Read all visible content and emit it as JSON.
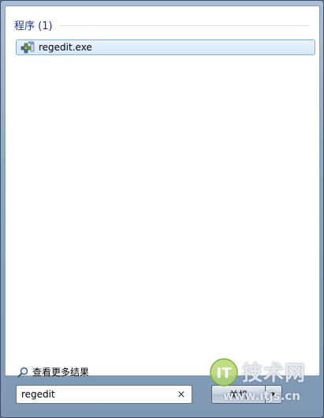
{
  "results": {
    "section_title": "程序 (1)",
    "items": [
      {
        "label": "regedit.exe",
        "icon": "regedit-icon"
      }
    ]
  },
  "see_more": {
    "label": "查看更多结果",
    "icon": "search-icon"
  },
  "search": {
    "value": "regedit",
    "clear_glyph": "×"
  },
  "shutdown": {
    "label": "关机",
    "arrow_glyph": "▶"
  },
  "watermark": {
    "logo_text": "IT",
    "title": "技术网",
    "url": "www.itjs.cn"
  },
  "colors": {
    "section_title": "#1e3287",
    "selection_border": "#84acdd",
    "frame": "#8ea8c3"
  }
}
